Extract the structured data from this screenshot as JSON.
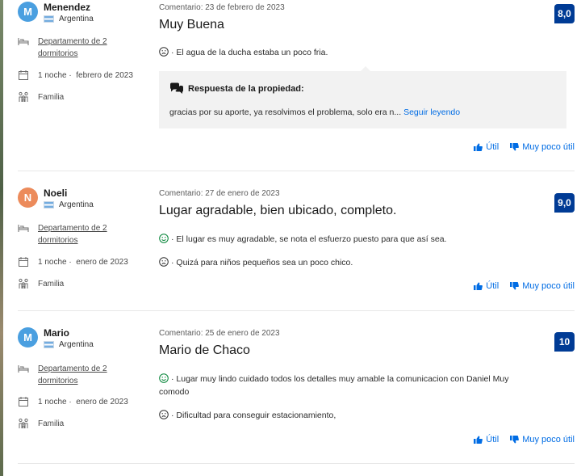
{
  "reviews": [
    {
      "initial": "M",
      "avatar_color": "#4a9fe0",
      "name": "Menendez",
      "country": "Argentina",
      "room": "Departamento de 2 dormitorios",
      "stay_nights": "1 noche ·",
      "stay_month": "febrero de 2023",
      "traveler": "Familia",
      "date": "Comentario: 23 de febrero de 2023",
      "title": "Muy Buena",
      "score": "8,0",
      "positive": "",
      "negative": "· El agua de la ducha estaba un poco fria.",
      "response_label": "Respuesta de la propiedad:",
      "response_text": "gracias por su aporte, ya resolvimos el problema, solo era n...",
      "response_more": "Seguir leyendo",
      "helpful": "Útil",
      "not_helpful": "Muy poco útil"
    },
    {
      "initial": "N",
      "avatar_color": "#ec8b5b",
      "name": "Noeli",
      "country": "Argentina",
      "room": "Departamento de 2 dormitorios",
      "stay_nights": "1 noche ·",
      "stay_month": "enero de 2023",
      "traveler": "Familia",
      "date": "Comentario: 27 de enero de 2023",
      "title": "Lugar agradable, bien ubicado, completo.",
      "score": "9,0",
      "positive": "· El lugar es muy agradable, se nota el esfuerzo puesto para que así sea.",
      "negative": "· Quizá para niños pequeños sea un poco chico.",
      "helpful": "Útil",
      "not_helpful": "Muy poco útil"
    },
    {
      "initial": "M",
      "avatar_color": "#4a9fe0",
      "name": "Mario",
      "country": "Argentina",
      "room": "Departamento de 2 dormitorios",
      "stay_nights": "1 noche ·",
      "stay_month": "enero de 2023",
      "traveler": "Familia",
      "date": "Comentario: 25 de enero de 2023",
      "title": "Mario de Chaco",
      "score": "10",
      "positive": "· Lugar muy lindo cuidado todos los detalles muy amable la comunicacion con Daniel Muy comodo",
      "negative": "· Dificultad para conseguir estacionamiento,",
      "helpful": "Útil",
      "not_helpful": "Muy poco útil"
    }
  ]
}
